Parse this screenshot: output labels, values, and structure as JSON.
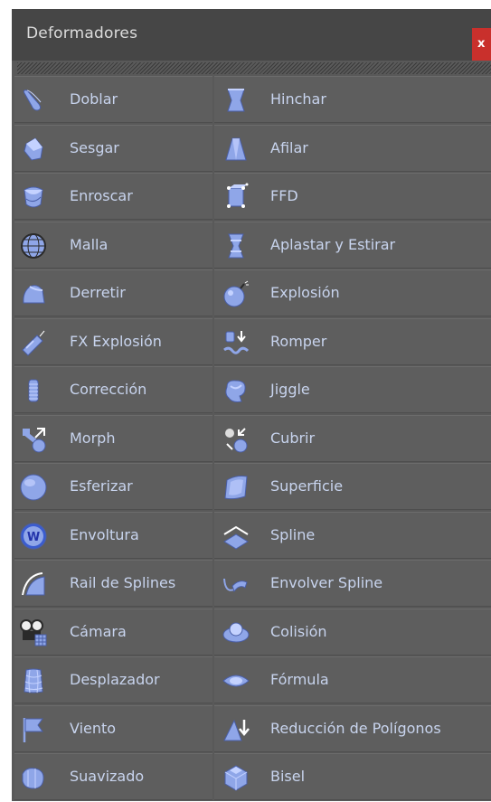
{
  "panel": {
    "title": "Deformadores",
    "close_label": "x"
  },
  "colors": {
    "panel_bg": "#595959",
    "titlebar_bg": "#464646",
    "label_text": "#c8d4ee",
    "icon_blue": "#8fa6e8",
    "close_red": "#c9302c"
  },
  "rows": [
    {
      "left": {
        "label": "Doblar",
        "icon": "bend-icon"
      },
      "right": {
        "label": "Hinchar",
        "icon": "bulge-icon"
      }
    },
    {
      "left": {
        "label": "Sesgar",
        "icon": "shear-icon"
      },
      "right": {
        "label": "Afilar",
        "icon": "taper-icon"
      }
    },
    {
      "left": {
        "label": "Enroscar",
        "icon": "twist-icon"
      },
      "right": {
        "label": "FFD",
        "icon": "ffd-icon"
      }
    },
    {
      "left": {
        "label": "Malla",
        "icon": "mesh-icon"
      },
      "right": {
        "label": "Aplastar y Estirar",
        "icon": "squash-stretch-icon"
      }
    },
    {
      "left": {
        "label": "Derretir",
        "icon": "melt-icon"
      },
      "right": {
        "label": "Explosión",
        "icon": "bomb-icon"
      }
    },
    {
      "left": {
        "label": "FX Explosión",
        "icon": "dynamite-icon"
      },
      "right": {
        "label": "Romper",
        "icon": "shatter-icon"
      }
    },
    {
      "left": {
        "label": "Corrección",
        "icon": "correction-icon"
      },
      "right": {
        "label": "Jiggle",
        "icon": "jiggle-icon"
      }
    },
    {
      "left": {
        "label": "Morph",
        "icon": "morph-icon"
      },
      "right": {
        "label": "Cubrir",
        "icon": "shrink-wrap-icon"
      }
    },
    {
      "left": {
        "label": "Esferizar",
        "icon": "spherify-icon"
      },
      "right": {
        "label": "Superficie",
        "icon": "surface-icon"
      }
    },
    {
      "left": {
        "label": "Envoltura",
        "icon": "wrap-icon"
      },
      "right": {
        "label": "Spline",
        "icon": "spline-icon"
      }
    },
    {
      "left": {
        "label": "Rail de Splines",
        "icon": "spline-rail-icon"
      },
      "right": {
        "label": "Envolver Spline",
        "icon": "spline-wrap-icon"
      }
    },
    {
      "left": {
        "label": "Cámara",
        "icon": "camera-icon"
      },
      "right": {
        "label": "Colisión",
        "icon": "collision-icon"
      }
    },
    {
      "left": {
        "label": "Desplazador",
        "icon": "displacer-icon"
      },
      "right": {
        "label": "Fórmula",
        "icon": "formula-icon"
      }
    },
    {
      "left": {
        "label": "Viento",
        "icon": "wind-flag-icon"
      },
      "right": {
        "label": "Reducción de Polígonos",
        "icon": "polygon-reduction-icon"
      }
    },
    {
      "left": {
        "label": "Suavizado",
        "icon": "smoothing-icon"
      },
      "right": {
        "label": "Bisel",
        "icon": "bevel-icon"
      }
    }
  ]
}
